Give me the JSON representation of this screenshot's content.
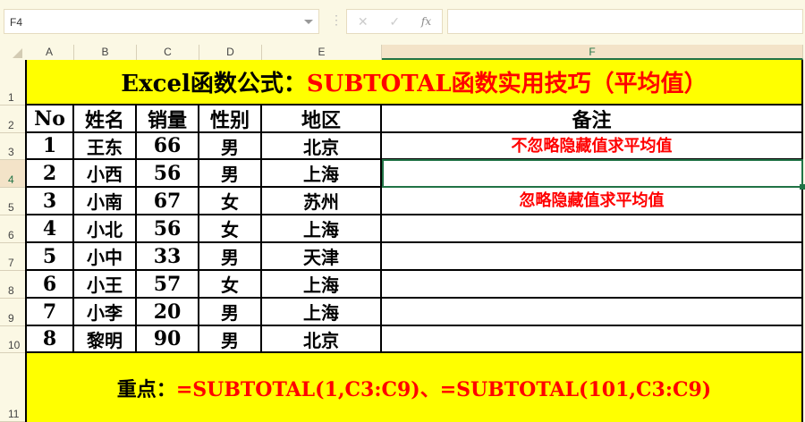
{
  "name_box": "F4",
  "formula_buttons": {
    "cancel": "✕",
    "confirm": "✓",
    "fx": "fx"
  },
  "formula_value": "",
  "columns": [
    "A",
    "B",
    "C",
    "D",
    "E",
    "F"
  ],
  "rows": [
    "1",
    "2",
    "3",
    "4",
    "5",
    "6",
    "7",
    "8",
    "9",
    "10",
    "11"
  ],
  "title": {
    "black": "Excel函数公式：",
    "red": "SUBTOTAL函数实用技巧（平均值）"
  },
  "headers": [
    "No",
    "姓名",
    "销量",
    "性别",
    "地区",
    "备注"
  ],
  "data": [
    [
      "1",
      "王东",
      "66",
      "男",
      "北京"
    ],
    [
      "2",
      "小西",
      "56",
      "男",
      "上海"
    ],
    [
      "3",
      "小南",
      "67",
      "女",
      "苏州"
    ],
    [
      "4",
      "小北",
      "56",
      "女",
      "上海"
    ],
    [
      "5",
      "小中",
      "33",
      "男",
      "天津"
    ],
    [
      "6",
      "小王",
      "57",
      "女",
      "上海"
    ],
    [
      "7",
      "小李",
      "20",
      "男",
      "上海"
    ],
    [
      "8",
      "黎明",
      "90",
      "男",
      "北京"
    ]
  ],
  "notes": {
    "row3": "不忽略隐藏值求平均值",
    "row4": "",
    "row5": "忽略隐藏值求平均值"
  },
  "footer": {
    "label": "重点：",
    "formula": "=SUBTOTAL(1,C3:C9)、=SUBTOTAL(101,C3:C9)"
  },
  "colors": {
    "accent": "#217346",
    "highlight": "#ffff00",
    "red": "#ff0000"
  }
}
